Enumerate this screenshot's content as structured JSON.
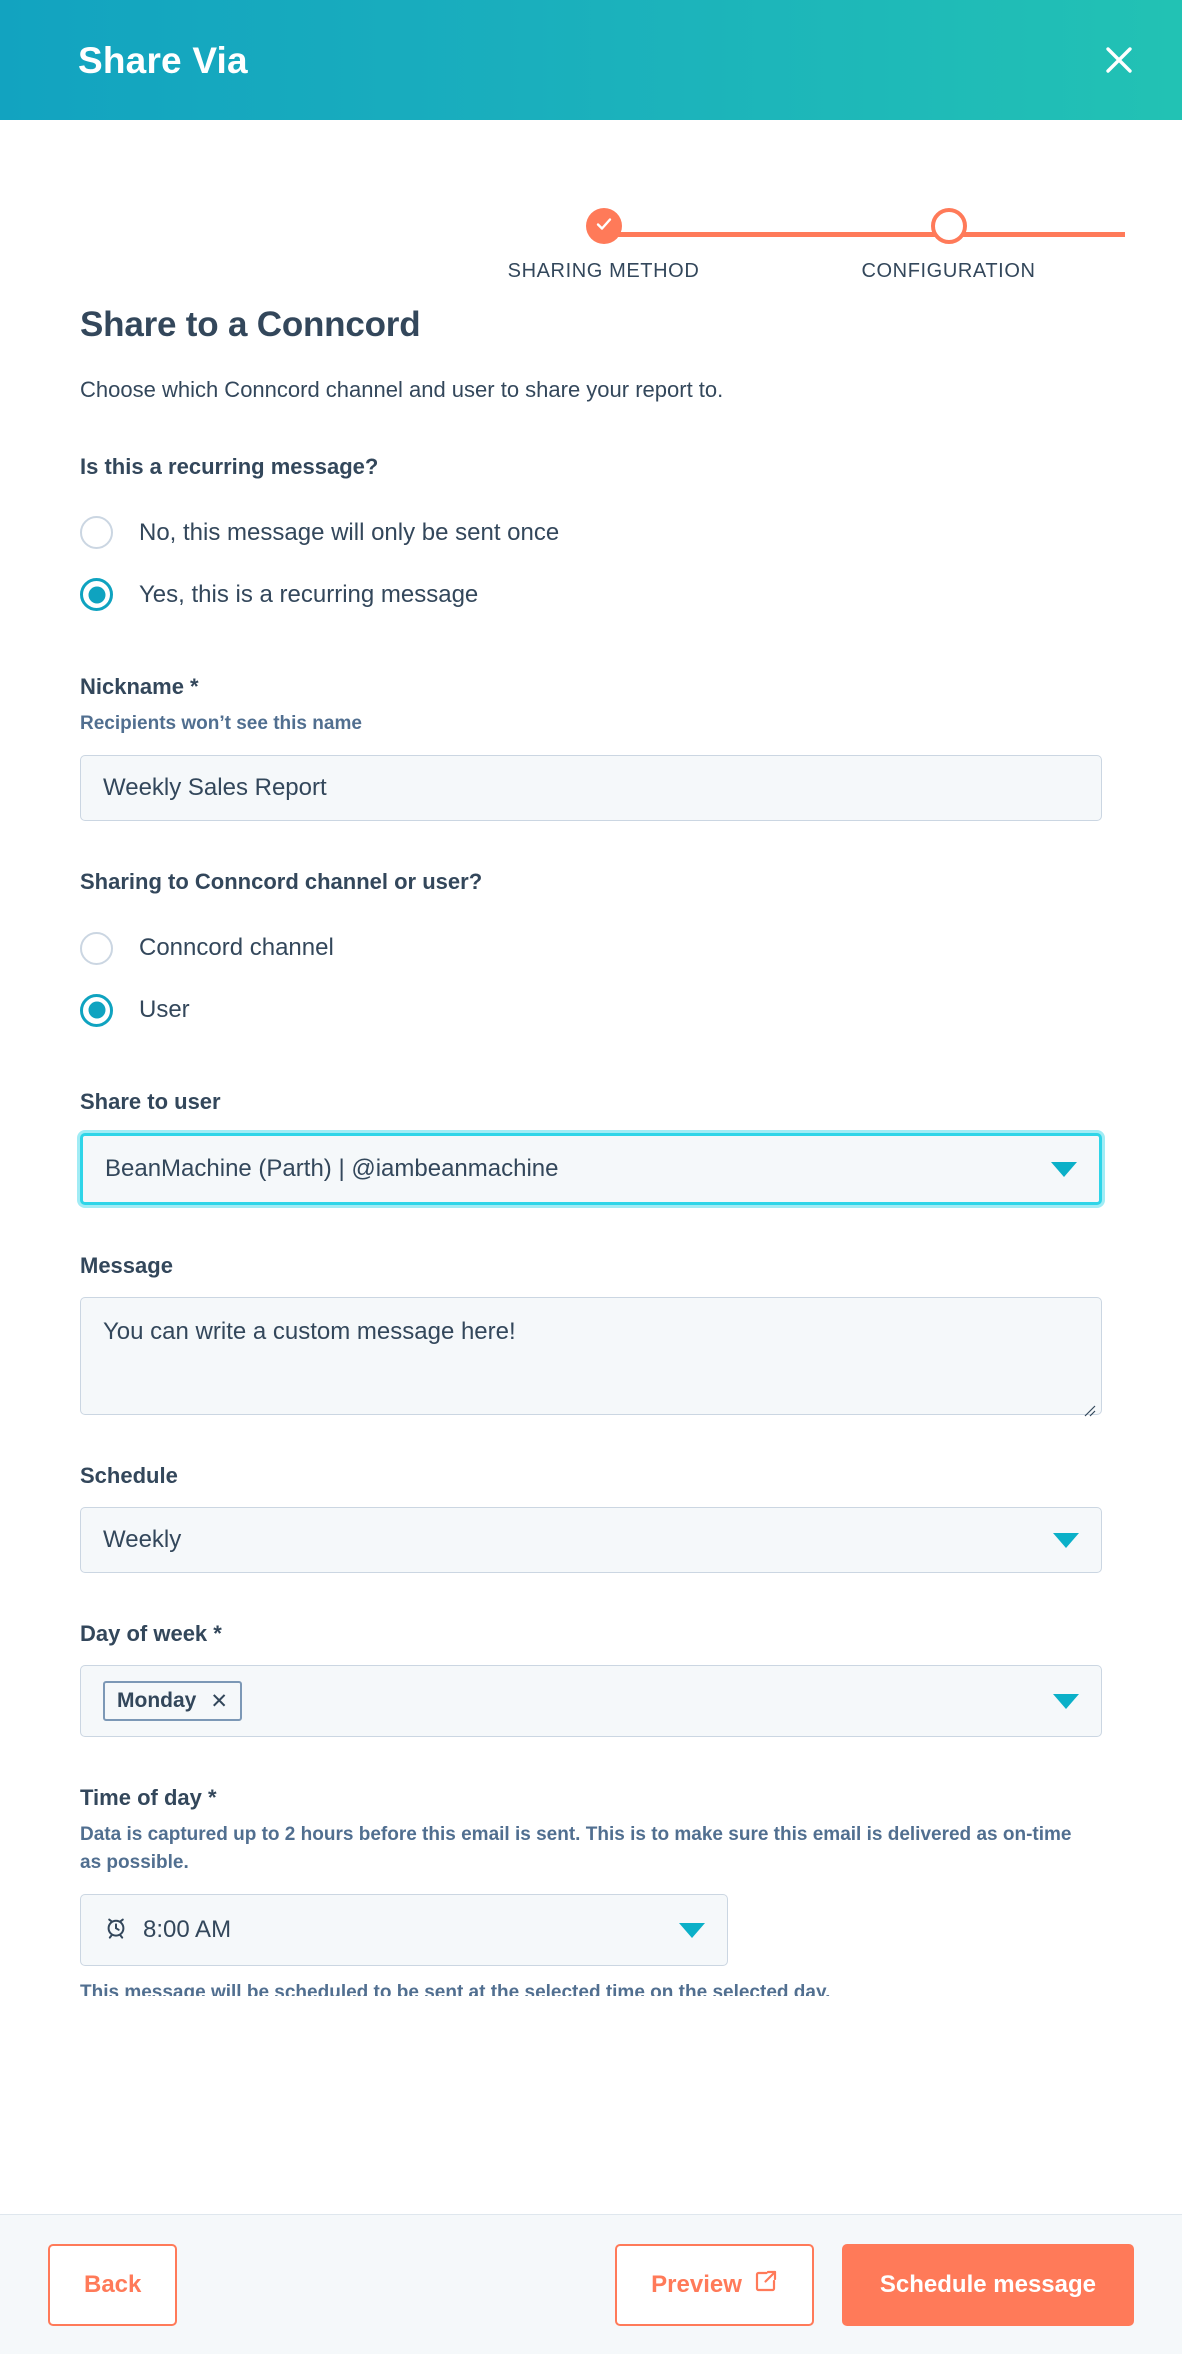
{
  "header": {
    "title": "Share Via",
    "close_icon": "close-icon",
    "gradient_start": "#12a3c0",
    "gradient_end": "#22c2b4"
  },
  "stepper": {
    "accent": "#ff7a59",
    "steps": [
      {
        "label": "SHARING METHOD",
        "state": "complete",
        "icon": "check-icon"
      },
      {
        "label": "CONFIGURATION",
        "state": "current",
        "icon": ""
      }
    ]
  },
  "main": {
    "section_title": "Share to a Conncord",
    "section_desc": "Choose which Conncord channel and user to share your report to.",
    "recurring": {
      "label": "Is this a recurring message?",
      "options": [
        {
          "label": "No, this message will only be sent once",
          "selected": false
        },
        {
          "label": "Yes, this is a recurring message",
          "selected": true
        }
      ]
    },
    "nickname": {
      "label": "Nickname *",
      "help": "Recipients won’t see this name",
      "value": "Weekly Sales Report"
    },
    "target_type": {
      "label": "Sharing to Conncord channel or user?",
      "options": [
        {
          "label": "Conncord channel",
          "selected": false
        },
        {
          "label": "User",
          "selected": true
        }
      ]
    },
    "share_to_user": {
      "label": "Share to user",
      "value": "BeanMachine (Parth) | @iambeanmachine",
      "focused": true
    },
    "message": {
      "label": "Message",
      "value": "You can write a custom message here!"
    },
    "schedule": {
      "label": "Schedule",
      "value": "Weekly"
    },
    "day_of_week": {
      "label": "Day of week *",
      "chip": "Monday",
      "chip_remove_icon": "close-icon"
    },
    "time_of_day": {
      "label": "Time of day *",
      "help": "Data is captured up to 2 hours before this email is sent. This is to make sure this email is delivered as on-time as possible.",
      "value": "8:00 AM",
      "icon": "alarm-clock-icon"
    },
    "truncated_note": "This message will be scheduled to be sent at the selected time on the selected day."
  },
  "footer": {
    "back_label": "Back",
    "preview_label": "Preview",
    "preview_icon": "external-link-icon",
    "submit_label": "Schedule message",
    "accent": "#ff7a59"
  }
}
